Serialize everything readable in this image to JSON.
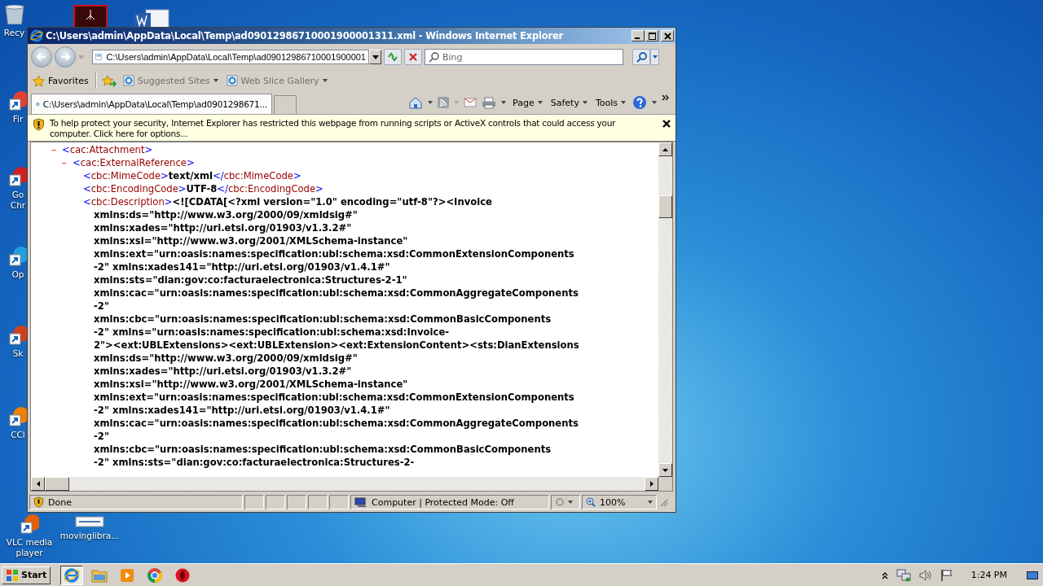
{
  "desktop": {
    "icons": [
      {
        "label": "Recy",
        "kind": "recycle"
      },
      {
        "label": "Fir",
        "kind": "shortcut"
      },
      {
        "label": "Go Chr",
        "kind": "shortcut"
      },
      {
        "label": "Op",
        "kind": "shortcut"
      },
      {
        "label": "Sk",
        "kind": "shortcut"
      },
      {
        "label": "CCl",
        "kind": "shortcut"
      },
      {
        "label": "VLC media player",
        "kind": "shortcut"
      },
      {
        "label": "movinglibra...",
        "kind": "file"
      }
    ]
  },
  "window": {
    "title": "C:\\Users\\admin\\AppData\\Local\\Temp\\ad09012986710001900001311.xml - Windows Internet Explorer"
  },
  "address_bar": {
    "value": "C:\\Users\\admin\\AppData\\Local\\Temp\\ad09012986710001900001"
  },
  "search": {
    "placeholder": "Bing"
  },
  "favorites_bar": {
    "label": "Favorites",
    "links": [
      "Suggested Sites",
      "Web Slice Gallery"
    ]
  },
  "tabs": [
    {
      "label": "C:\\Users\\admin\\AppData\\Local\\Temp\\ad0901298671...",
      "selected": true
    }
  ],
  "command_bar": [
    "Page",
    "Safety",
    "Tools"
  ],
  "info_bar": {
    "text": "To help protect your security, Internet Explorer has restricted this webpage from running scripts or ActiveX controls that could access your computer. Click here for options..."
  },
  "xml": {
    "nodes": [
      {
        "kind": "element",
        "toggle": "–",
        "expanded": true,
        "segments": [
          {
            "kind": "punct",
            "text": "<"
          },
          {
            "kind": "name",
            "text": "cac:Attachment"
          },
          {
            "kind": "punct",
            "text": ">"
          }
        ],
        "children": [
          {
            "kind": "element",
            "toggle": "–",
            "expanded": true,
            "segments": [
              {
                "kind": "punct",
                "text": "<"
              },
              {
                "kind": "name",
                "text": "cac:ExternalReference"
              },
              {
                "kind": "punct",
                "text": ">"
              }
            ],
            "children": [
              {
                "kind": "leaf",
                "segments": [
                  {
                    "kind": "punct",
                    "text": "<"
                  },
                  {
                    "kind": "name",
                    "text": "cbc:MimeCode"
                  },
                  {
                    "kind": "punct",
                    "text": ">"
                  },
                  {
                    "kind": "text",
                    "text": "text/xml"
                  },
                  {
                    "kind": "punct",
                    "text": "</"
                  },
                  {
                    "kind": "name",
                    "text": "cbc:MimeCode"
                  },
                  {
                    "kind": "punct",
                    "text": ">"
                  }
                ]
              },
              {
                "kind": "leaf",
                "segments": [
                  {
                    "kind": "punct",
                    "text": "<"
                  },
                  {
                    "kind": "name",
                    "text": "cbc:EncodingCode"
                  },
                  {
                    "kind": "punct",
                    "text": ">"
                  },
                  {
                    "kind": "text",
                    "text": "UTF-8"
                  },
                  {
                    "kind": "punct",
                    "text": "</"
                  },
                  {
                    "kind": "name",
                    "text": "cbc:EncodingCode"
                  },
                  {
                    "kind": "punct",
                    "text": ">"
                  }
                ]
              },
              {
                "kind": "leaf",
                "segments": [
                  {
                    "kind": "punct",
                    "text": "<"
                  },
                  {
                    "kind": "name",
                    "text": "cbc:Description"
                  },
                  {
                    "kind": "punct",
                    "text": ">"
                  },
                  {
                    "kind": "text",
                    "text": "<![CDATA[<?xml version=\"1.0\" encoding=\"utf-8\"?><Invoice"
                  }
                ],
                "lines": [
                  "xmlns:ds=\"http://www.w3.org/2000/09/xmldsig#\"",
                  "xmlns:xades=\"http://uri.etsi.org/01903/v1.3.2#\"",
                  "xmlns:xsi=\"http://www.w3.org/2001/XMLSchema-instance\"",
                  "xmlns:ext=\"urn:oasis:names:specification:ubl:schema:xsd:CommonExtensionComponents",
                  "-2\" xmlns:xades141=\"http://uri.etsi.org/01903/v1.4.1#\"",
                  "xmlns:sts=\"dian:gov:co:facturaelectronica:Structures-2-1\"",
                  "xmlns:cac=\"urn:oasis:names:specification:ubl:schema:xsd:CommonAggregateComponents",
                  "-2\"",
                  "xmlns:cbc=\"urn:oasis:names:specification:ubl:schema:xsd:CommonBasicComponents",
                  "-2\" xmlns=\"urn:oasis:names:specification:ubl:schema:xsd:Invoice-",
                  "2\"><ext:UBLExtensions><ext:UBLExtension><ext:ExtensionContent><sts:DianExtensions",
                  "xmlns:ds=\"http://www.w3.org/2000/09/xmldsig#\"",
                  "xmlns:xades=\"http://uri.etsi.org/01903/v1.3.2#\"",
                  "xmlns:xsi=\"http://www.w3.org/2001/XMLSchema-instance\"",
                  "xmlns:ext=\"urn:oasis:names:specification:ubl:schema:xsd:CommonExtensionComponents",
                  "-2\" xmlns:xades141=\"http://uri.etsi.org/01903/v1.4.1#\"",
                  "xmlns:cac=\"urn:oasis:names:specification:ubl:schema:xsd:CommonAggregateComponents",
                  "-2\"",
                  "xmlns:cbc=\"urn:oasis:names:specification:ubl:schema:xsd:CommonBasicComponents",
                  "-2\" xmlns:sts=\"dian:gov:co:facturaelectronica:Structures-2-"
                ]
              }
            ]
          }
        ]
      }
    ]
  },
  "status_bar": {
    "status": "Done",
    "zone": "Computer | Protected Mode: Off",
    "zoom": "100%"
  },
  "taskbar": {
    "start": "Start",
    "pinned": [
      {
        "kind": "ie",
        "selected": true
      },
      {
        "kind": "folder",
        "selected": false
      },
      {
        "kind": "media",
        "selected": false
      },
      {
        "kind": "chrome",
        "selected": false
      },
      {
        "kind": "opera",
        "selected": false
      }
    ],
    "clock": "1:24 PM"
  }
}
